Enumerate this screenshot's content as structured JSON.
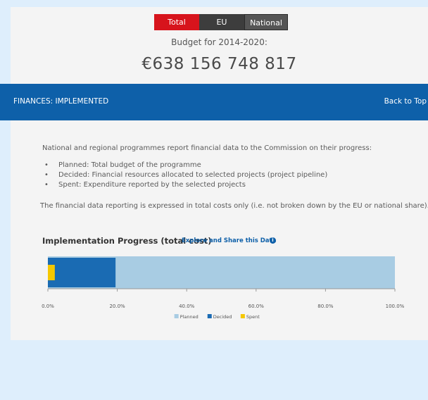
{
  "tabs": [
    {
      "label": "Total",
      "active": true,
      "color": "#d7141c"
    },
    {
      "label": "EU",
      "active": false
    },
    {
      "label": "National",
      "active": false
    }
  ],
  "budget": {
    "label": "Budget for 2014-2020:",
    "value": "€638 156 748 817"
  },
  "section": {
    "title": "FINANCES: IMPLEMENTED",
    "back_to_top": "Back to Top",
    "color": "#0e60a9"
  },
  "description": {
    "intro": "National and regional programmes report financial data to the Commission on their progress:",
    "items": [
      "Planned: Total budget of the programme",
      "Decided: Financial resources allocated to selected projects (project pipeline)",
      "Spent: Expenditure reported by the selected projects"
    ],
    "note": "The financial data reporting is expressed in total costs only (i.e. not broken down by the EU or national share)."
  },
  "chart_header": {
    "title": "Implementation Progress (total cost)",
    "explore_link": "Explore and Share this Data",
    "info_icon": "info-circle-icon"
  },
  "chart_data": {
    "type": "bar",
    "orientation": "horizontal",
    "title": "Implementation Progress (total cost)",
    "xlim": [
      0,
      100
    ],
    "x_ticks": [
      "0.0%",
      "20.0%",
      "40.0%",
      "60.0%",
      "80.0%",
      "100.0%"
    ],
    "series": [
      {
        "name": "Planned",
        "value": 100,
        "color": "#a8cce3"
      },
      {
        "name": "Decided",
        "value": 19.5,
        "color": "#1a6bb3"
      },
      {
        "name": "Spent",
        "value": 2,
        "color": "#f5c800"
      }
    ],
    "legend_position": "bottom-center",
    "grid": false
  }
}
